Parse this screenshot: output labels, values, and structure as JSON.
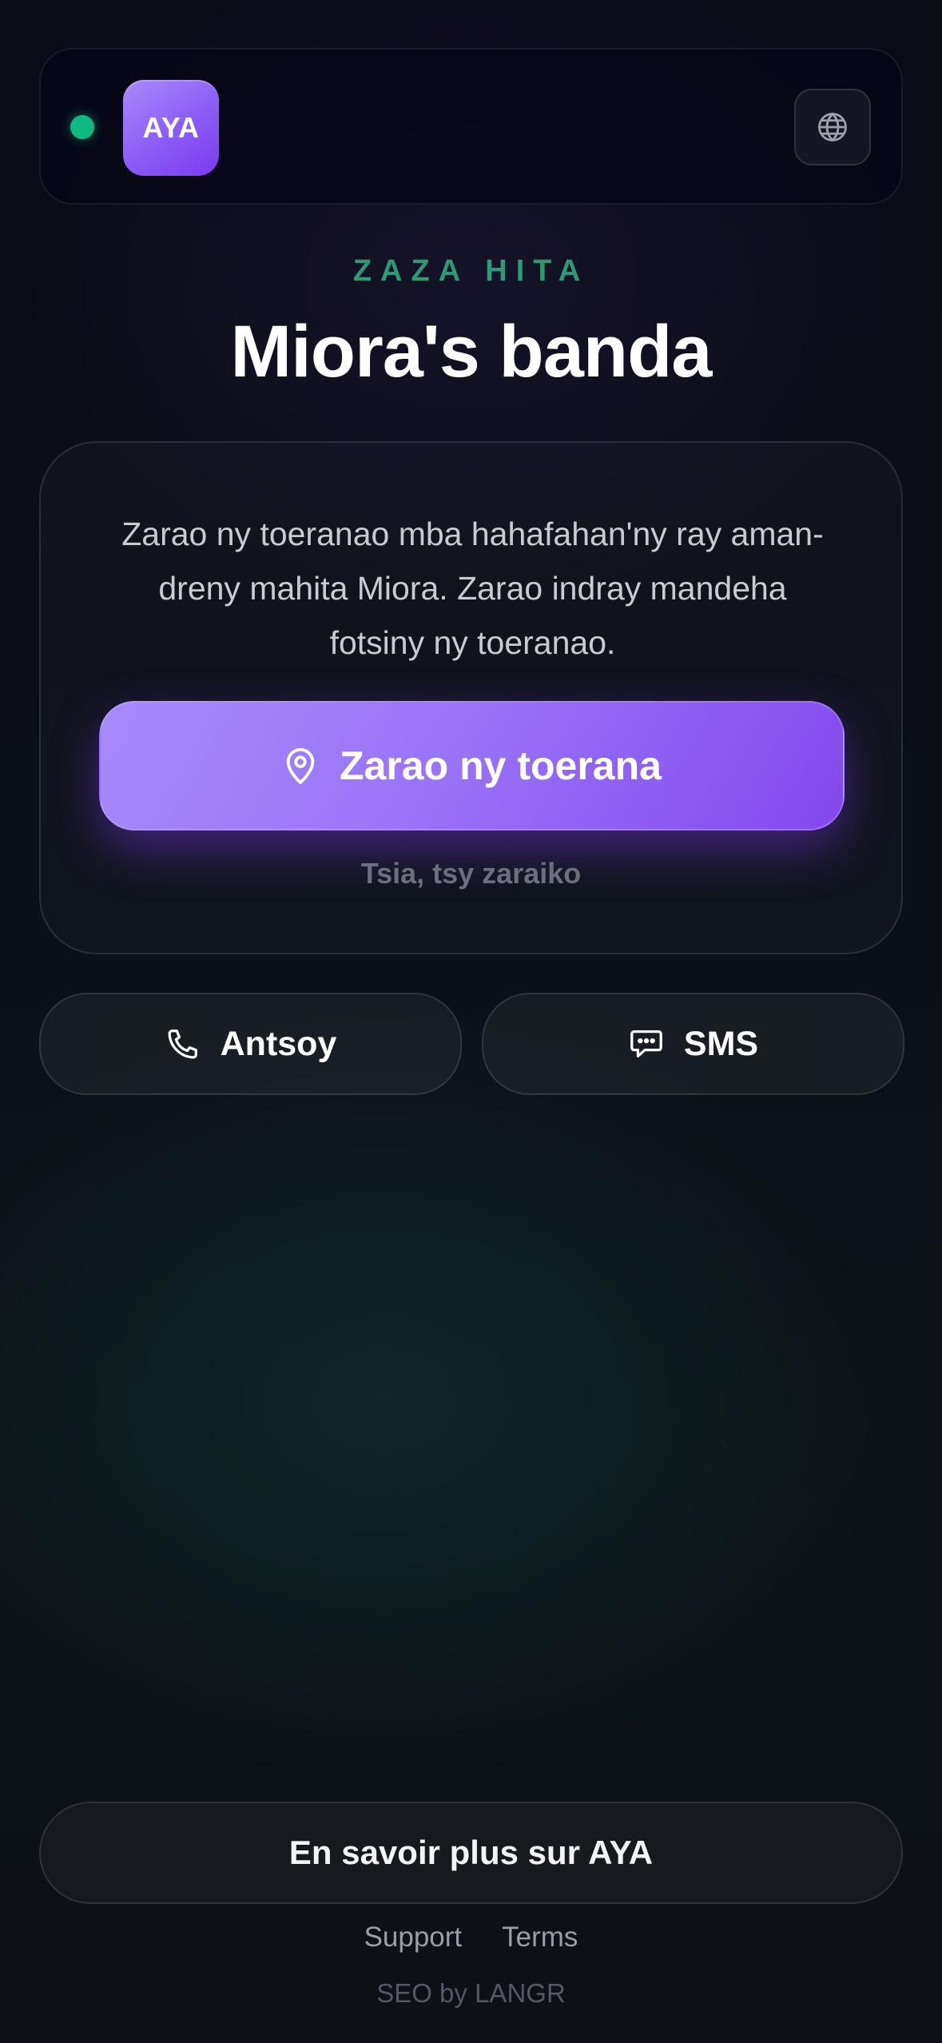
{
  "header": {
    "logo_text": "AYA",
    "status_color": "#10b981",
    "language_icon": "globe-icon"
  },
  "hero": {
    "eyebrow": "ZAZA HITA",
    "title": "Miora's banda"
  },
  "card": {
    "description": "Zarao ny toeranao mba hahafahan'ny ray aman-dreny mahita Miora. Zarao indray mandeha fotsiny ny toeranao.",
    "primary_button_label": "Zarao ny toerana",
    "primary_button_icon": "location-pin-icon",
    "decline_label": "Tsia, tsy zaraiko"
  },
  "contact": {
    "call_label": "Antsoy",
    "call_icon": "phone-icon",
    "sms_label": "SMS",
    "sms_icon": "chat-bubble-icon"
  },
  "footer": {
    "learn_more_label": "En savoir plus sur AYA",
    "support_label": "Support",
    "terms_label": "Terms",
    "credit": "SEO by LANGR"
  },
  "colors": {
    "accent": "#8b5cf6",
    "eyebrow": "#2c9a75",
    "background": "#0b0f17"
  }
}
